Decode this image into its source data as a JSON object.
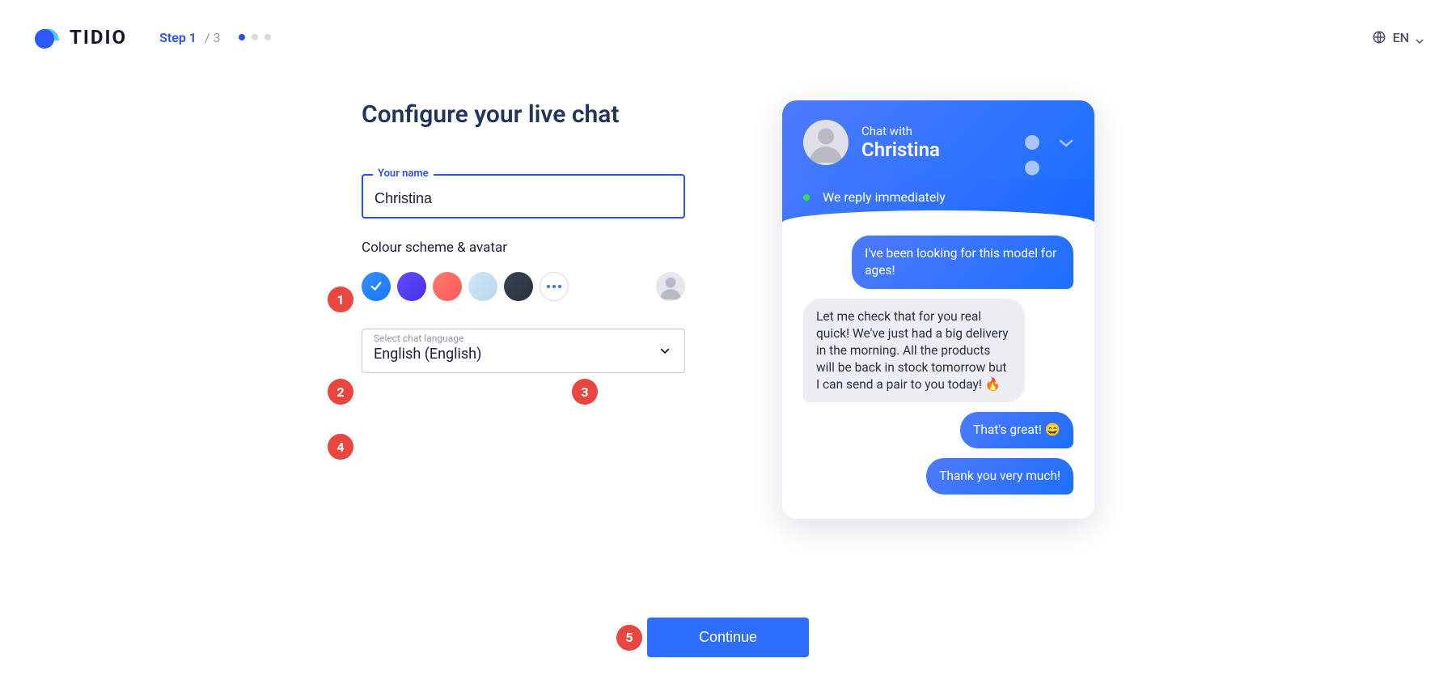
{
  "brand": {
    "name": "TIDIO"
  },
  "steps": {
    "current_label": "Step 1",
    "total_label": "/ 3",
    "current_index": 1,
    "total": 3
  },
  "language_picker": {
    "code": "EN"
  },
  "page": {
    "title": "Configure your live chat"
  },
  "form": {
    "name_field": {
      "label": "Your name",
      "value": "Christina"
    },
    "color_section_label": "Colour scheme & avatar",
    "swatches": [
      {
        "color": "linear-gradient(135deg,#3192ff,#1b74ff)",
        "selected": true,
        "name": "color-blue"
      },
      {
        "color": "linear-gradient(135deg,#5f4bff,#4831e6)",
        "selected": false,
        "name": "color-indigo"
      },
      {
        "color": "linear-gradient(135deg,#ff7b6b,#f85a5a)",
        "selected": false,
        "name": "color-coral"
      },
      {
        "color": "linear-gradient(135deg,#cfe6f7,#b7d8f0)",
        "selected": false,
        "name": "color-lightblue"
      },
      {
        "color": "linear-gradient(135deg,#3a4251,#2b3240)",
        "selected": false,
        "name": "color-charcoal"
      }
    ],
    "language_select": {
      "label": "Select chat language",
      "value": "English (English)"
    }
  },
  "preview": {
    "chat_with_label": "Chat with",
    "chat_name": "Christina",
    "status_text": "We reply immediately",
    "messages": [
      {
        "side": "user",
        "text": "I've been looking for this model for ages!"
      },
      {
        "side": "agent",
        "text": "Let me check that for you real quick! We've just had a big delivery in the morning. All the products will be back in stock tomorrow but I can send a pair to you today! 🔥"
      },
      {
        "side": "user",
        "text": "That's great! 😄"
      },
      {
        "side": "user",
        "text": "Thank you very much!"
      }
    ]
  },
  "footer": {
    "continue_label": "Continue"
  },
  "callouts": {
    "one": "1",
    "two": "2",
    "three": "3",
    "four": "4",
    "five": "5"
  }
}
